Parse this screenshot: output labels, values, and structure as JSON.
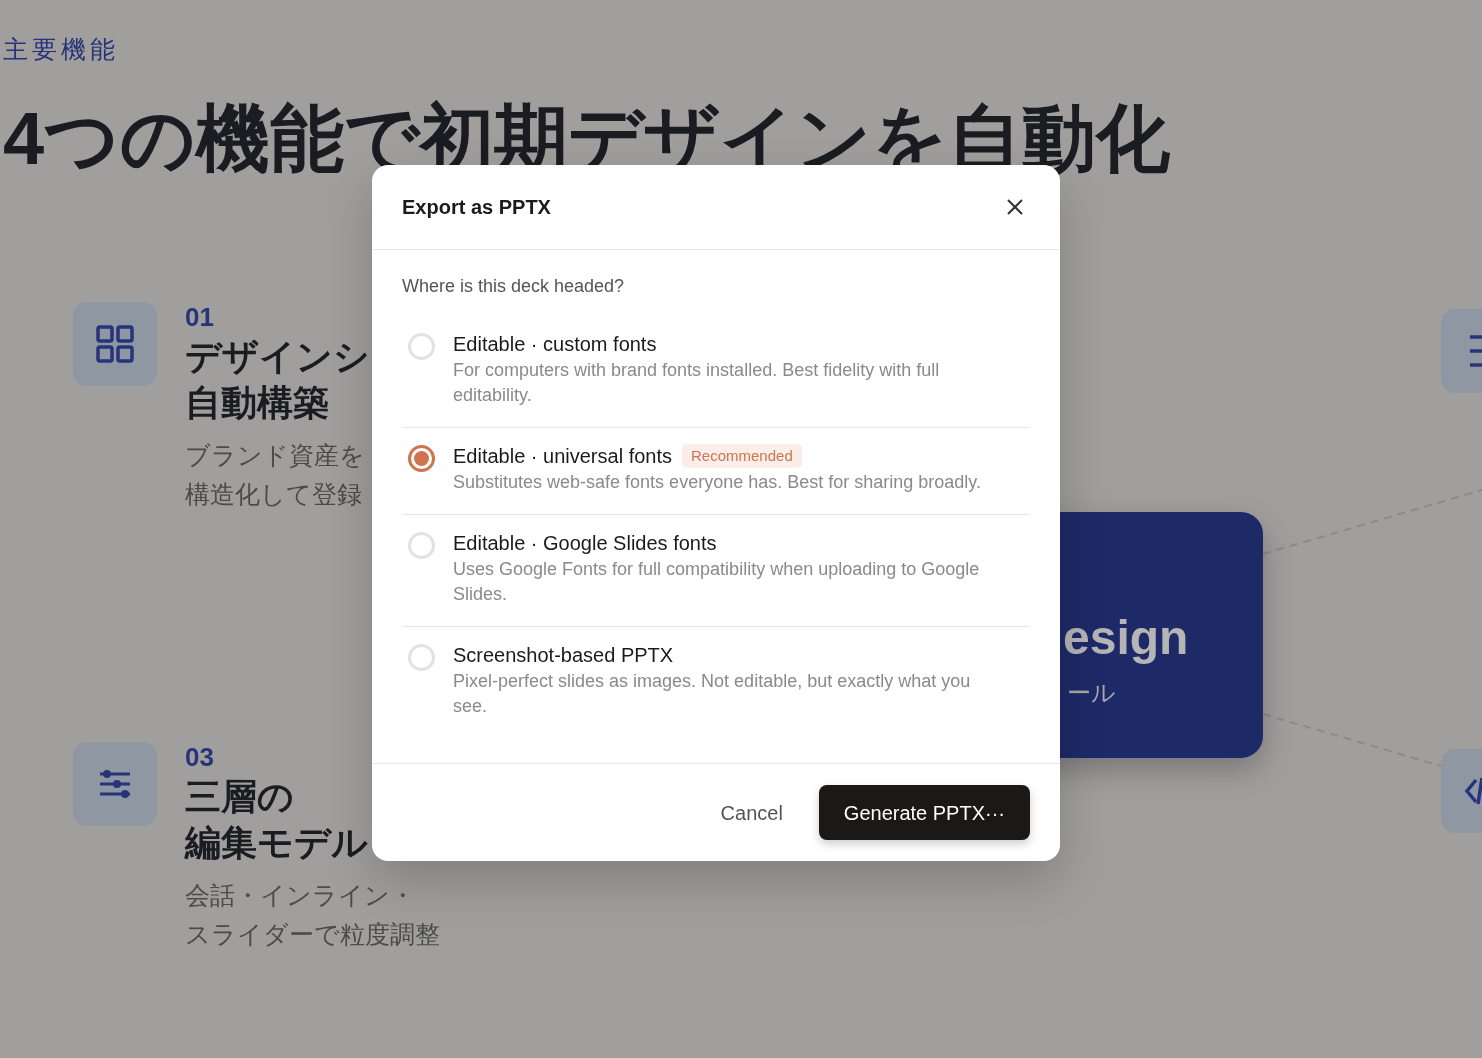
{
  "background": {
    "eyebrow": "主要機能",
    "heading": "4つの機能で初期デザインを自動化",
    "features": [
      {
        "number": "01",
        "title_lines": [
          "デザインシ",
          "自動構築"
        ],
        "desc_lines": [
          "ブランド資産を",
          "構造化して登録"
        ]
      },
      {
        "number": "03",
        "title_lines": [
          "三層の",
          "編集モデル"
        ],
        "desc_lines": [
          "会話・インライン・",
          "スライダーで粒度調整"
        ]
      }
    ],
    "center_card": {
      "title": "esign",
      "subtitle": "ール"
    },
    "side_tiles": [
      {
        "kind": "list"
      },
      {
        "kind": "code"
      }
    ]
  },
  "dialog": {
    "title": "Export as PPTX",
    "question": "Where is this deck headed?",
    "options": [
      {
        "title": "Editable · custom fonts",
        "description": "For computers with brand fonts installed. Best fidelity with full editability.",
        "selected": false
      },
      {
        "title": "Editable · universal fonts",
        "badge": "Recommended",
        "description": "Substitutes web-safe fonts everyone has. Best for sharing broadly.",
        "selected": true
      },
      {
        "title": "Editable · Google Slides fonts",
        "description": "Uses Google Fonts for full compatibility when uploading to Google Slides.",
        "selected": false
      },
      {
        "title": "Screenshot-based PPTX",
        "description": "Pixel-perfect slides as images. Not editable, but exactly what you see.",
        "selected": false
      }
    ],
    "cancel": "Cancel",
    "primary": "Generate PPTX···"
  }
}
